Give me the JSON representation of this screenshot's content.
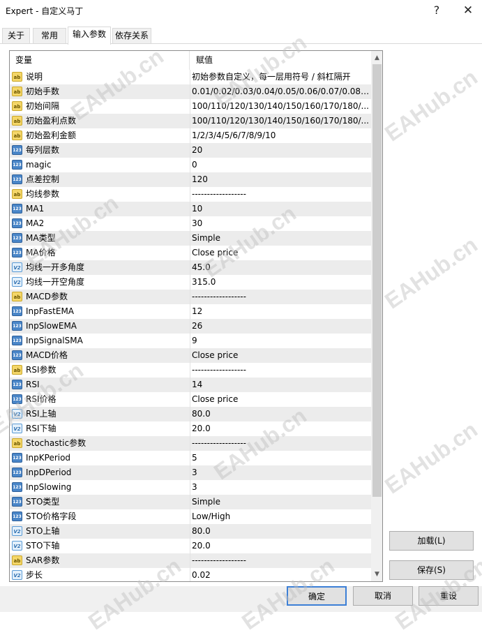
{
  "window": {
    "title": "Expert - 自定义马丁",
    "help_glyph": "?",
    "close_glyph": "✕"
  },
  "tabs": [
    {
      "label": "关于",
      "active": false
    },
    {
      "label": "常用",
      "active": false
    },
    {
      "label": "输入参数",
      "active": true
    },
    {
      "label": "依存关系",
      "active": false
    }
  ],
  "table": {
    "headers": {
      "variable": "变量",
      "value": "赋值"
    },
    "rows": [
      {
        "icon": "ab",
        "name": "说明",
        "value": "初始参数自定义，每一层用符号 / 斜杠隔开"
      },
      {
        "icon": "ab",
        "name": "初始手数",
        "value": "0.01/0.02/0.03/0.04/0.05/0.06/0.07/0.08/0...."
      },
      {
        "icon": "ab",
        "name": "初始间隔",
        "value": "100/110/120/130/140/150/160/170/180/..."
      },
      {
        "icon": "ab",
        "name": "初始盈利点数",
        "value": "100/110/120/130/140/150/160/170/180/..."
      },
      {
        "icon": "ab",
        "name": "初始盈利金额",
        "value": "1/2/3/4/5/6/7/8/9/10"
      },
      {
        "icon": "123",
        "name": "每列层数",
        "value": "20"
      },
      {
        "icon": "123",
        "name": "magic",
        "value": "0"
      },
      {
        "icon": "123",
        "name": "点差控制",
        "value": "120"
      },
      {
        "icon": "ab",
        "name": "均线参数",
        "value": "------------------"
      },
      {
        "icon": "123",
        "name": "MA1",
        "value": "10"
      },
      {
        "icon": "123",
        "name": "MA2",
        "value": "30"
      },
      {
        "icon": "123",
        "name": "MA类型",
        "value": "Simple"
      },
      {
        "icon": "123",
        "name": "MA价格",
        "value": "Close price"
      },
      {
        "icon": "v2",
        "name": "均线一开多角度",
        "value": "45.0"
      },
      {
        "icon": "v2",
        "name": "均线一开空角度",
        "value": "315.0"
      },
      {
        "icon": "ab",
        "name": "MACD参数",
        "value": "------------------"
      },
      {
        "icon": "123",
        "name": "InpFastEMA",
        "value": "12"
      },
      {
        "icon": "123",
        "name": "InpSlowEMA",
        "value": "26"
      },
      {
        "icon": "123",
        "name": "InpSignalSMA",
        "value": "9"
      },
      {
        "icon": "123",
        "name": "MACD价格",
        "value": "Close price"
      },
      {
        "icon": "ab",
        "name": "RSI参数",
        "value": "------------------"
      },
      {
        "icon": "123",
        "name": "RSI",
        "value": "14"
      },
      {
        "icon": "123",
        "name": "RSI价格",
        "value": "Close price"
      },
      {
        "icon": "v2",
        "name": "RSI上轴",
        "value": "80.0"
      },
      {
        "icon": "v2",
        "name": "RSI下轴",
        "value": "20.0"
      },
      {
        "icon": "ab",
        "name": "Stochastic参数",
        "value": "------------------"
      },
      {
        "icon": "123",
        "name": "InpKPeriod",
        "value": "5"
      },
      {
        "icon": "123",
        "name": "InpDPeriod",
        "value": "3"
      },
      {
        "icon": "123",
        "name": "InpSlowing",
        "value": "3"
      },
      {
        "icon": "123",
        "name": "STO类型",
        "value": "Simple"
      },
      {
        "icon": "123",
        "name": "STO价格字段",
        "value": "Low/High"
      },
      {
        "icon": "v2",
        "name": "STO上轴",
        "value": "80.0"
      },
      {
        "icon": "v2",
        "name": "STO下轴",
        "value": "20.0"
      },
      {
        "icon": "ab",
        "name": "SAR参数",
        "value": "------------------"
      },
      {
        "icon": "v2",
        "name": "步长",
        "value": "0.02"
      }
    ]
  },
  "icon_glyphs": {
    "ab": "ab",
    "123": "123",
    "v2": "V2"
  },
  "buttons": {
    "load": "加载(L)",
    "save": "保存(S)",
    "ok": "确定",
    "cancel": "取消",
    "reset": "重设"
  },
  "watermark": "EAHub.cn",
  "colors": {
    "ok_border": "#3c7fd6",
    "alt_row": "#ececec"
  }
}
